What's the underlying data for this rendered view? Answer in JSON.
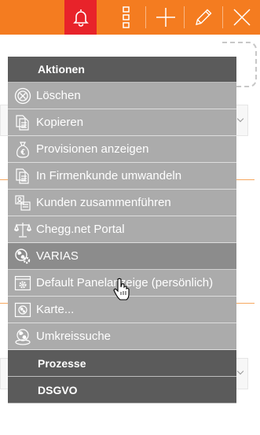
{
  "toolbar": {
    "buttons": [
      {
        "name": "bell-icon",
        "active": true
      },
      {
        "name": "more-vertical-icon",
        "active": false
      },
      {
        "name": "plus-icon",
        "active": false
      },
      {
        "name": "pencil-icon",
        "active": false
      },
      {
        "name": "close-icon",
        "active": false
      }
    ],
    "colors": {
      "bar": "#f47c20",
      "active": "#e8232a",
      "icon": "#ffffff"
    }
  },
  "menu": {
    "header": "Aktionen",
    "items": [
      {
        "label": "Löschen",
        "icon": "delete-circle-icon"
      },
      {
        "label": "Kopieren",
        "icon": "copy-document-icon"
      },
      {
        "label": "Provisionen anzeigen",
        "icon": "money-bag-icon"
      },
      {
        "label": "In Firmenkunde umwandeln",
        "icon": "document-convert-icon"
      },
      {
        "label": "Kunden zusammenführen",
        "icon": "merge-customers-icon"
      },
      {
        "label": "Chegg.net Portal",
        "icon": "scales-icon"
      },
      {
        "label": "VARIAS",
        "icon": "globe-gear-icon",
        "hovered": true
      },
      {
        "label": "Default Panelanzeige (persönlich)",
        "icon": "panel-settings-icon"
      },
      {
        "label": "Karte...",
        "icon": "map-globe-icon"
      },
      {
        "label": "Umkreissuche",
        "icon": "radius-search-icon"
      }
    ],
    "sections": [
      "Prozesse",
      "DSGVO"
    ],
    "colors": {
      "header": "#5b5b5b",
      "item": "#ababab",
      "item_hover": "#8c8c8c",
      "text": "#ffffff"
    }
  }
}
